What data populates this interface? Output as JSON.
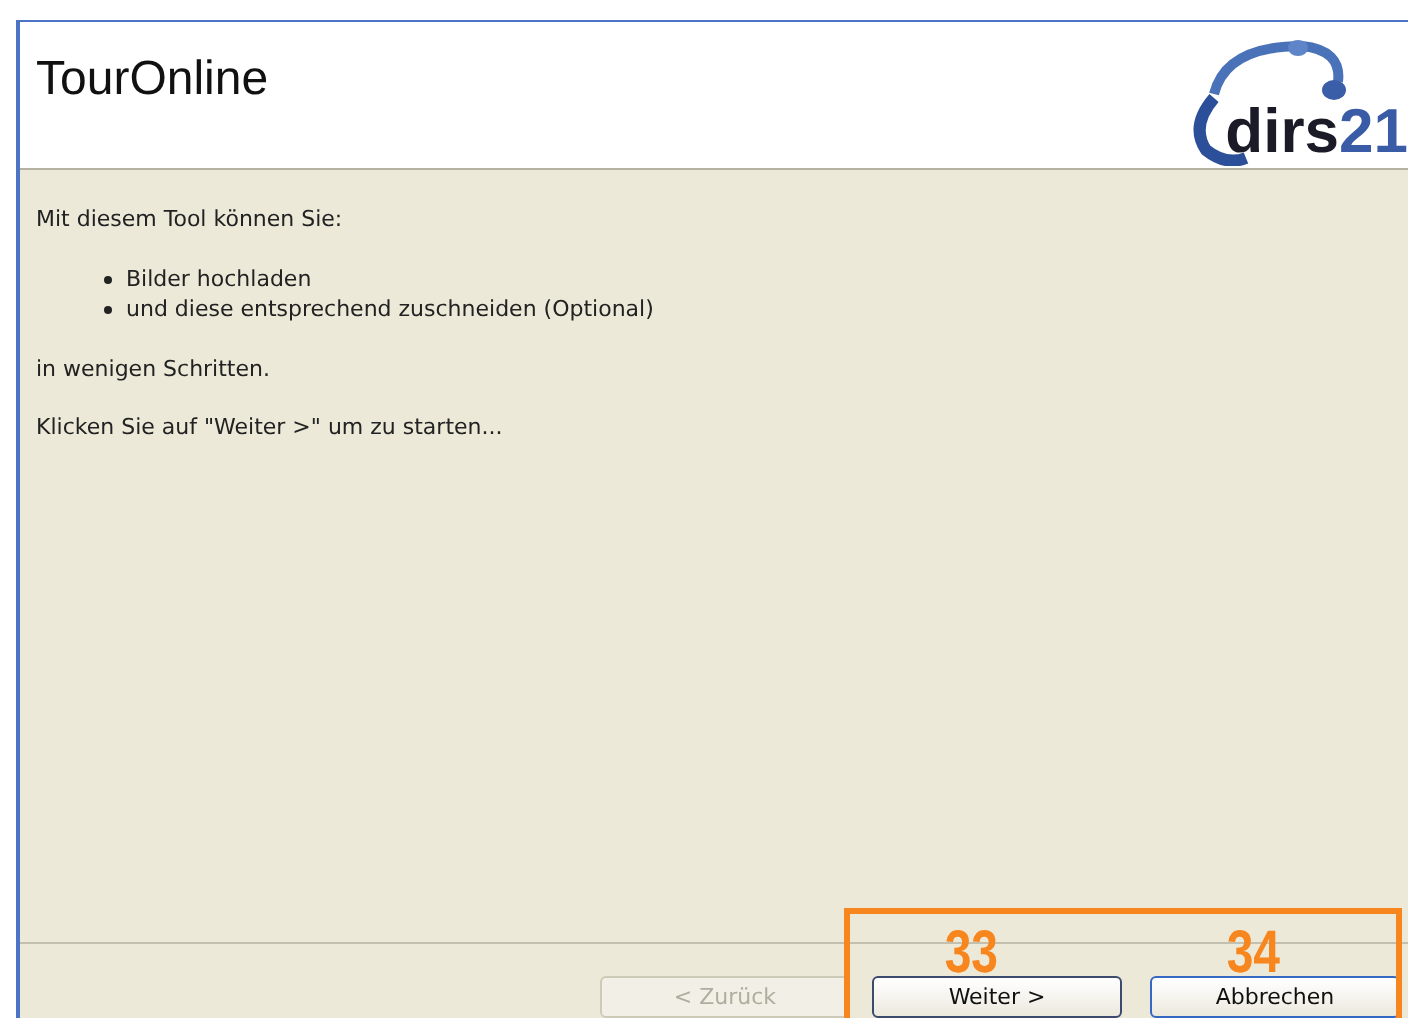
{
  "header": {
    "title": "TourOnline",
    "logo": {
      "text": "dirs",
      "number": "21"
    }
  },
  "body": {
    "intro": "Mit diesem Tool können Sie:",
    "bullets": [
      "Bilder hochladen",
      "und diese entsprechend zuschneiden (Optional)"
    ],
    "paragraphs": [
      "in wenigen Schritten.",
      "Klicken Sie auf \"Weiter >\" um zu starten..."
    ]
  },
  "buttons": [
    {
      "label": "< Zurück",
      "disabled": true
    },
    {
      "label": "Weiter >",
      "disabled": false
    },
    {
      "label": "Abbrechen",
      "disabled": false
    }
  ],
  "annotation": {
    "labels": [
      "33",
      "34"
    ]
  }
}
